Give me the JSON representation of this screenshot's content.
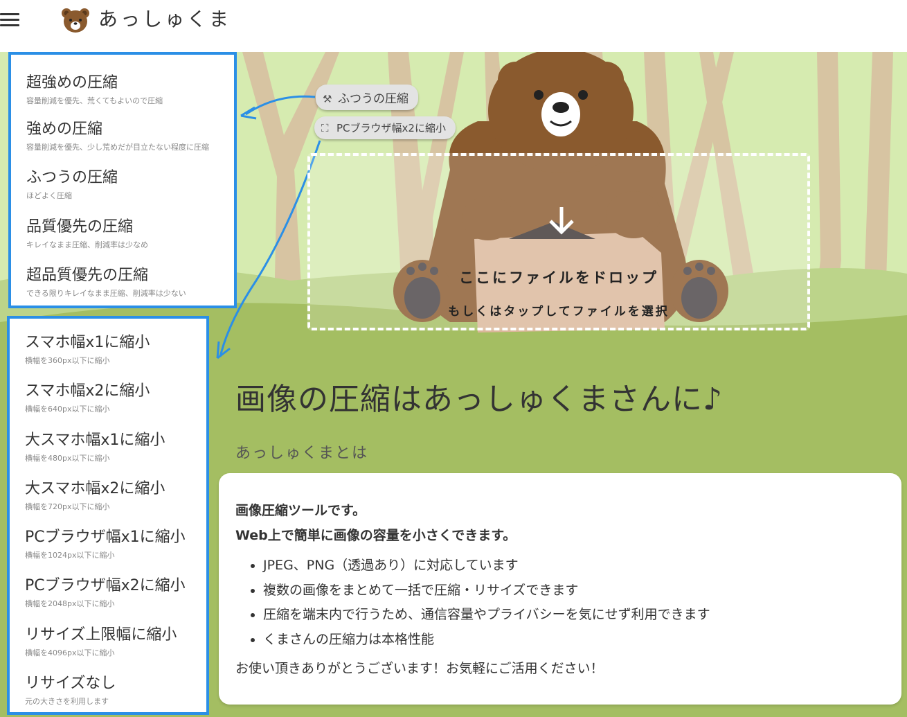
{
  "header": {
    "app_name": "あっしゅくま",
    "menu_icon": "hamburger-menu-icon",
    "logo_icon": "bear-face-logo-icon"
  },
  "chips": {
    "current_compression": "ふつうの圧縮",
    "current_compression_icon": "hammer-icon",
    "current_resize": "PCブラウザ幅x2に縮小",
    "current_resize_icon": "fullscreen-icon"
  },
  "dropzone": {
    "main": "ここにファイルをドロップ",
    "sub": "もしくはタップしてファイルを選択",
    "icon": "download-arrow-icon"
  },
  "compression_menu": {
    "items": [
      {
        "label": "超強めの圧縮",
        "desc": "容量削減を優先、荒くてもよいので圧縮"
      },
      {
        "label": "強めの圧縮",
        "desc": "容量削減を優先、少し荒めだが目立たない程度に圧縮"
      },
      {
        "label": "ふつうの圧縮",
        "desc": "ほどよく圧縮"
      },
      {
        "label": "品質優先の圧縮",
        "desc": "キレイなまま圧縮、削減率は少なめ"
      },
      {
        "label": "超品質優先の圧縮",
        "desc": "できる限りキレイなまま圧縮、削減率は少ない"
      }
    ]
  },
  "resize_menu": {
    "items": [
      {
        "label": "スマホ幅x1に縮小",
        "desc": "横幅を360px以下に縮小"
      },
      {
        "label": "スマホ幅x2に縮小",
        "desc": "横幅を640px以下に縮小"
      },
      {
        "label": "大スマホ幅x1に縮小",
        "desc": "横幅を480px以下に縮小"
      },
      {
        "label": "大スマホ幅x2に縮小",
        "desc": "横幅を720px以下に縮小"
      },
      {
        "label": "PCブラウザ幅x1に縮小",
        "desc": "横幅を1024px以下に縮小"
      },
      {
        "label": "PCブラウザ幅x2に縮小",
        "desc": "横幅を2048px以下に縮小"
      },
      {
        "label": "リサイズ上限幅に縮小",
        "desc": "横幅を4096px以下に縮小"
      },
      {
        "label": "リサイズなし",
        "desc": "元の大きさを利用します"
      }
    ]
  },
  "main": {
    "title": "画像の圧縮はあっしゅくまさんに♪",
    "about_title": "あっしゅくまとは",
    "lead1": "画像圧縮ツールです。",
    "lead2": "Web上で簡単に画像の容量を小さくできます。",
    "features": [
      "JPEG、PNG（透過あり）に対応しています",
      "複数の画像をまとめて一括で圧縮・リサイズできます",
      "圧縮を端末内で行うため、通信容量やプライバシーを気にせず利用できます",
      "くまさんの圧縮力は本格性能"
    ],
    "thanks": "お使い頂きありがとうございます！お気軽にご活用ください！"
  },
  "colors": {
    "menu_border": "#2b8fe6",
    "forest_light": "#d6ebb0",
    "ground": "#a4be62",
    "bear_brown": "#8a5a2e"
  }
}
